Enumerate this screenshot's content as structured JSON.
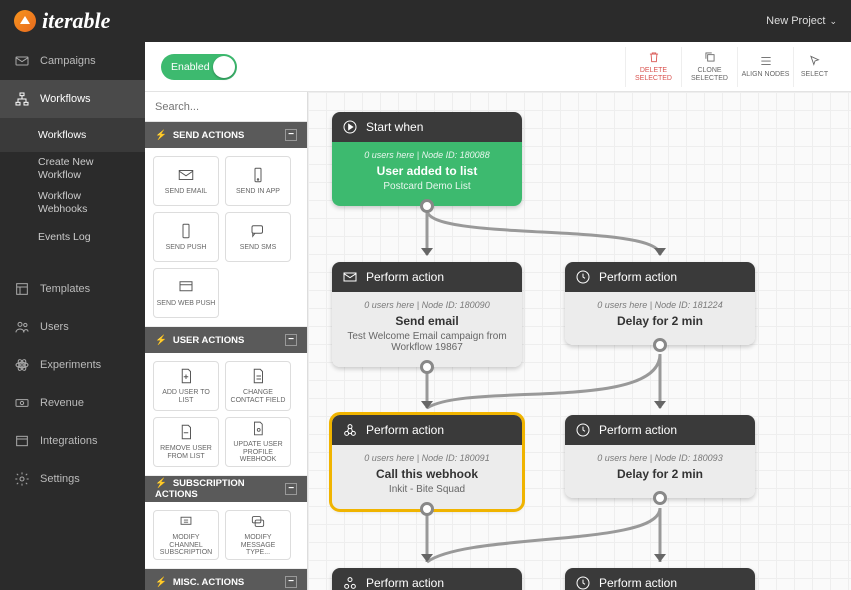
{
  "brand": "iterable",
  "project_dropdown": "New Project",
  "sidebar": {
    "items": [
      {
        "label": "Campaigns",
        "icon": "envelope"
      },
      {
        "label": "Workflows",
        "icon": "workflow",
        "active": true
      },
      {
        "label": "Templates",
        "icon": "templates"
      },
      {
        "label": "Users",
        "icon": "users"
      },
      {
        "label": "Experiments",
        "icon": "atom"
      },
      {
        "label": "Revenue",
        "icon": "money"
      },
      {
        "label": "Integrations",
        "icon": "window"
      },
      {
        "label": "Settings",
        "icon": "gear"
      }
    ],
    "workflow_sub": [
      {
        "label": "Workflows",
        "active": true
      },
      {
        "label": "Create New Workflow"
      },
      {
        "label": "Workflow Webhooks"
      },
      {
        "label": "Events Log"
      }
    ]
  },
  "toolbar": {
    "toggle_label": "Enabled",
    "buttons": [
      {
        "label": "DELETE SELECTED",
        "icon": "trash",
        "danger": true
      },
      {
        "label": "CLONE SELECTED",
        "icon": "copy"
      },
      {
        "label": "ALIGN NODES",
        "icon": "align"
      },
      {
        "label": "SELECT",
        "icon": "cursor",
        "truncated": true
      }
    ]
  },
  "palette": {
    "search_placeholder": "Search...",
    "sections": [
      {
        "title": "SEND ACTIONS",
        "tiles": [
          {
            "label": "SEND EMAIL",
            "icon": "envelope"
          },
          {
            "label": "SEND IN APP",
            "icon": "phone-app"
          },
          {
            "label": "SEND PUSH",
            "icon": "phone"
          },
          {
            "label": "SEND SMS",
            "icon": "chat"
          },
          {
            "label": "SEND WEB PUSH",
            "icon": "browser"
          }
        ]
      },
      {
        "title": "USER ACTIONS",
        "tiles": [
          {
            "label": "ADD USER TO LIST",
            "icon": "doc-plus"
          },
          {
            "label": "CHANGE CONTACT FIELD",
            "icon": "doc-edit"
          },
          {
            "label": "REMOVE USER FROM LIST",
            "icon": "doc-minus"
          },
          {
            "label": "UPDATE USER PROFILE WEBHOOK",
            "icon": "doc-gear"
          }
        ]
      },
      {
        "title": "SUBSCRIPTION ACTIONS",
        "tiles": [
          {
            "label": "MODIFY CHANNEL SUBSCRIPTION",
            "icon": "channel"
          },
          {
            "label": "MODIFY MESSAGE TYPE...",
            "icon": "msgtype"
          }
        ]
      },
      {
        "title": "MISC. ACTIONS",
        "tiles": []
      }
    ]
  },
  "nodes": {
    "start": {
      "hdr": "Start when",
      "meta": "0 users here | Node ID: 180088",
      "title": "User added to list",
      "desc": "Postcard Demo List"
    },
    "email": {
      "hdr": "Perform action",
      "meta": "0 users here | Node ID: 180090",
      "title": "Send email",
      "desc": "Test Welcome Email campaign from Workflow 19867"
    },
    "delay1": {
      "hdr": "Perform action",
      "meta": "0 users here | Node ID: 181224",
      "title": "Delay for 2 min",
      "desc": ""
    },
    "webhook": {
      "hdr": "Perform action",
      "meta": "0 users here | Node ID: 180091",
      "title": "Call this webhook",
      "desc": "Inkit - Bite Squad"
    },
    "delay2": {
      "hdr": "Perform action",
      "meta": "0 users here | Node ID: 180093",
      "title": "Delay for 2 min",
      "desc": ""
    },
    "bottom1": {
      "hdr": "Perform action"
    },
    "bottom2": {
      "hdr": "Perform action"
    }
  }
}
